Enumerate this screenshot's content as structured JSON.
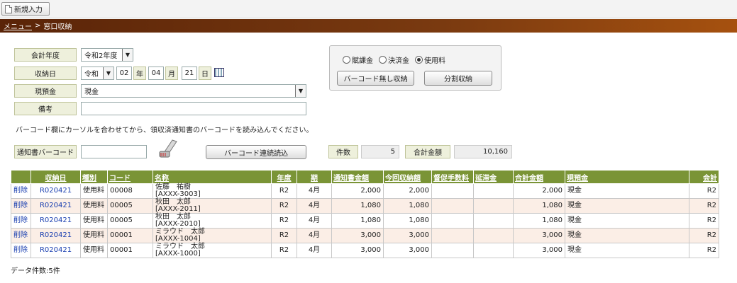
{
  "toolbar": {
    "new_entry": "新規入力"
  },
  "breadcrumb": {
    "menu": "メニュー",
    "separator": ">",
    "current": "窓口収納"
  },
  "form": {
    "fiscal_year_label": "会計年度",
    "fiscal_year_value": "令和2年度",
    "receipt_date_label": "収納日",
    "era": "令和",
    "year": "02",
    "year_unit": "年",
    "month": "04",
    "month_unit": "月",
    "day": "21",
    "day_unit": "日",
    "cash_label": "現預金",
    "cash_value": "現金",
    "remarks_label": "備考",
    "remarks_value": "",
    "instruction": "バーコード欄にカーソルを合わせてから、領収済通知書のバーコードを読み込んでください。",
    "barcode_label": "通知書バーコード",
    "barcode_value": "",
    "barcode_read_button": "バーコード連続読込",
    "count_label": "件数",
    "count_value": "5",
    "total_label": "合計金額",
    "total_value": "10,160"
  },
  "options": {
    "radios": [
      {
        "label": "賦課金",
        "checked": false
      },
      {
        "label": "決済金",
        "checked": false
      },
      {
        "label": "使用料",
        "checked": true
      }
    ],
    "no_barcode_button": "バーコード無し収納",
    "split_button": "分割収納"
  },
  "table": {
    "headers": [
      "",
      "収納日",
      "種別",
      "コード",
      "名称",
      "年度",
      "期",
      "通知書金額",
      "今回収納額",
      "督促手数料",
      "延滞金",
      "合計金額",
      "現預金",
      "会計"
    ],
    "rows": [
      {
        "action": "削除",
        "date": "R020421",
        "type": "使用料",
        "code": "00008",
        "name": "佐藤　祐樹",
        "id": "[AXXX-3003]",
        "year": "R2",
        "period": "4月",
        "notice_amount": "2,000",
        "received": "2,000",
        "fee": "",
        "late": "",
        "total": "2,000",
        "cash": "現金",
        "account": "R2"
      },
      {
        "action": "削除",
        "date": "R020421",
        "type": "使用料",
        "code": "00005",
        "name": "秋田　太郎",
        "id": "[AXXX-2011]",
        "year": "R2",
        "period": "4月",
        "notice_amount": "1,080",
        "received": "1,080",
        "fee": "",
        "late": "",
        "total": "1,080",
        "cash": "現金",
        "account": "R2"
      },
      {
        "action": "削除",
        "date": "R020421",
        "type": "使用料",
        "code": "00005",
        "name": "秋田　太郎",
        "id": "[AXXX-2010]",
        "year": "R2",
        "period": "4月",
        "notice_amount": "1,080",
        "received": "1,080",
        "fee": "",
        "late": "",
        "total": "1,080",
        "cash": "現金",
        "account": "R2"
      },
      {
        "action": "削除",
        "date": "R020421",
        "type": "使用料",
        "code": "00001",
        "name": "ミラウド　太郎",
        "id": "[AXXX-1004]",
        "year": "R2",
        "period": "4月",
        "notice_amount": "3,000",
        "received": "3,000",
        "fee": "",
        "late": "",
        "total": "3,000",
        "cash": "現金",
        "account": "R2"
      },
      {
        "action": "削除",
        "date": "R020421",
        "type": "使用料",
        "code": "00001",
        "name": "ミラウド　太郎",
        "id": "[AXXX-1000]",
        "year": "R2",
        "period": "4月",
        "notice_amount": "3,000",
        "received": "3,000",
        "fee": "",
        "late": "",
        "total": "3,000",
        "cash": "現金",
        "account": "R2"
      }
    ],
    "record_count": "データ件数:5件"
  }
}
